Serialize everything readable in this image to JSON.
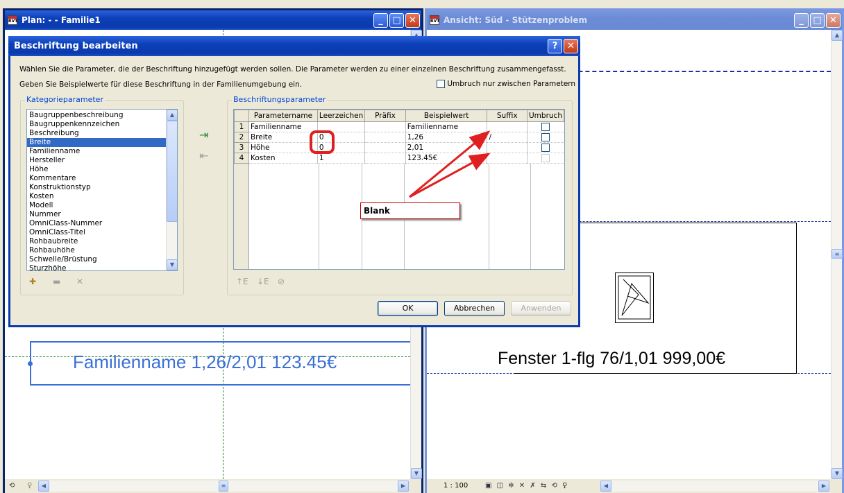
{
  "plan_window": {
    "title": "Plan:  -  - Familie1"
  },
  "elev_window": {
    "title": "Ansicht: Süd - Stützenproblem"
  },
  "plan_label": "Familienname 1,26/2,01  123.45€",
  "elev_label": "Fenster 1-flg 76/1,01  999,00€",
  "elev_status": {
    "scale": "1 : 100"
  },
  "dialog": {
    "title": "Beschriftung bearbeiten",
    "instructions": [
      "Wählen Sie die Parameter, die der Beschriftung hinzugefügt werden sollen. Die Parameter werden zu einer einzelnen Beschriftung zusammengefasst.",
      "Geben Sie Beispielwerte für diese Beschriftung in der Familienumgebung ein."
    ],
    "wrap_checkbox_label": "Umbruch nur zwischen Parametern",
    "category_group_label": "Kategorieparameter",
    "categories": [
      "Baugruppenbeschreibung",
      "Baugruppenkennzeichen",
      "Beschreibung",
      "Breite",
      "Familienname",
      "Hersteller",
      "Höhe",
      "Kommentare",
      "Konstruktionstyp",
      "Kosten",
      "Modell",
      "Nummer",
      "OmniClass-Nummer",
      "OmniClass-Titel",
      "Rohbaubreite",
      "Rohbauhöhe",
      "Schwelle/Brüstung",
      "Sturzhöhe"
    ],
    "selected_category": "Breite",
    "label_group_label": "Beschriftungsparameter",
    "columns": [
      "Parametername",
      "Leerzeichen",
      "Präfix",
      "Beispielwert",
      "Suffix",
      "Umbruch"
    ],
    "rows": [
      {
        "n": "1",
        "name": "Familienname",
        "spaces": "",
        "prefix": "",
        "sample": "Familienname",
        "suffix": ""
      },
      {
        "n": "2",
        "name": "Breite",
        "spaces": "0",
        "prefix": "",
        "sample": "1,26",
        "suffix": "/"
      },
      {
        "n": "3",
        "name": "Höhe",
        "spaces": "0",
        "prefix": "",
        "sample": "2,01",
        "suffix": ""
      },
      {
        "n": "4",
        "name": "Kosten",
        "spaces": "1",
        "prefix": "",
        "sample": "123.45€",
        "suffix": ""
      }
    ],
    "buttons": {
      "ok": "OK",
      "cancel": "Abbrechen",
      "apply": "Anwenden"
    }
  },
  "annotation": {
    "callout_text": "Blank",
    "accent": "#e02020"
  },
  "colors": {
    "title_active": "#0a3aad",
    "label_blue": "#3a6fd8",
    "selection": "#316ac5"
  }
}
